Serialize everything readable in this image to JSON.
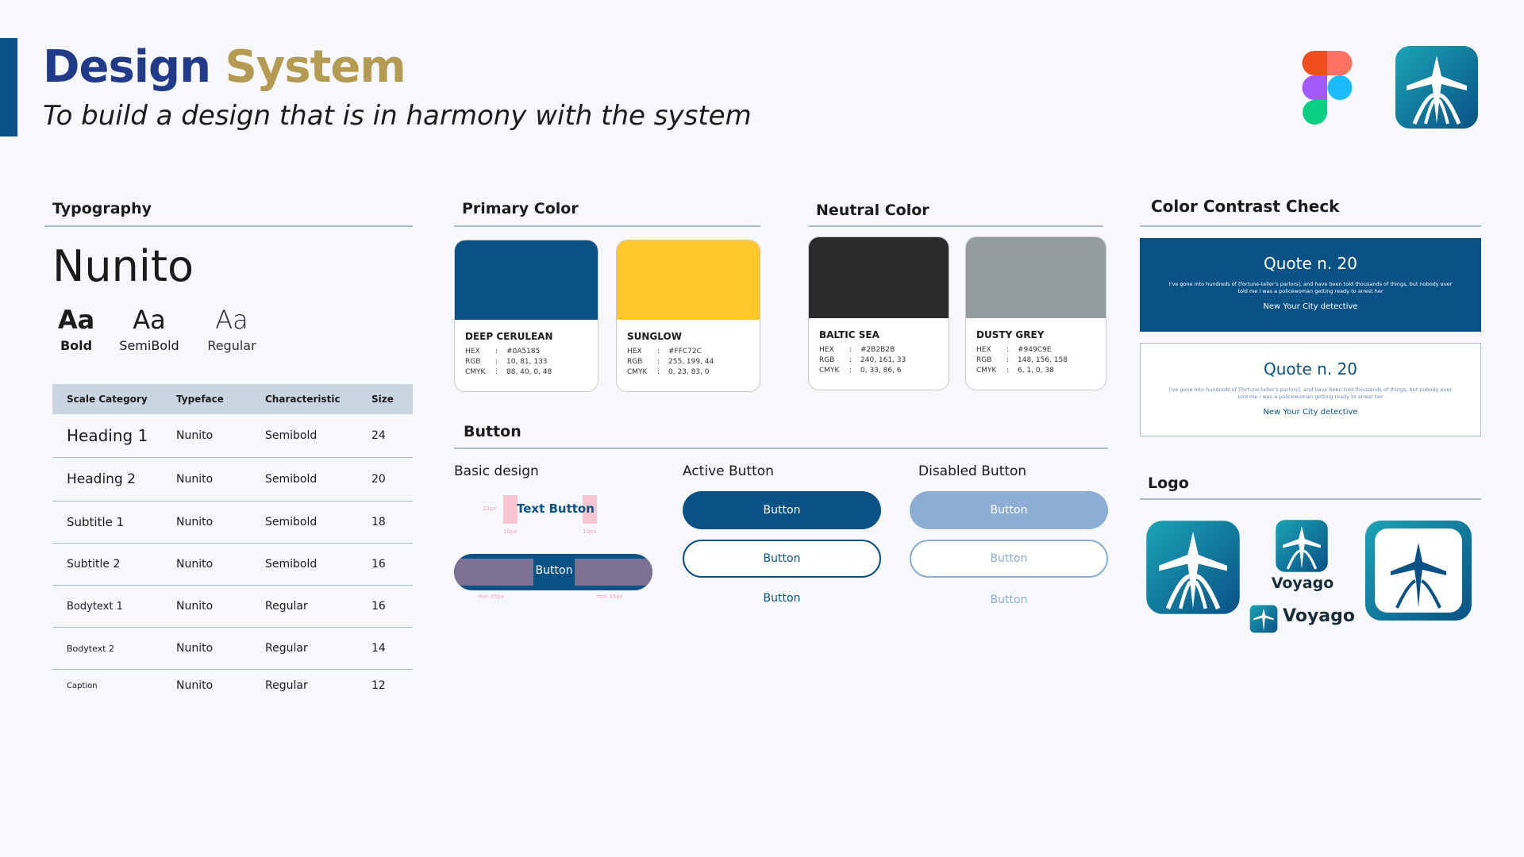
{
  "header": {
    "title_part1": "Design",
    "title_part2": "System",
    "subtitle": "To build a design that is in harmony with the system",
    "icons": [
      "figma-logo-icon",
      "voyago-app-icon"
    ]
  },
  "typography": {
    "section_title": "Typography",
    "font_name": "Nunito",
    "samples": [
      {
        "glyph": "Aa",
        "label": "Bold"
      },
      {
        "glyph": "Aa",
        "label": "SemiBold"
      },
      {
        "glyph": "Aa",
        "label": "Regular"
      }
    ],
    "columns": [
      "Scale Category",
      "Typeface",
      "Characteristic",
      "Size"
    ],
    "rows": [
      {
        "category": "Heading 1",
        "typeface": "Nunito",
        "characteristic": "Semibold",
        "size": "24"
      },
      {
        "category": "Heading 2",
        "typeface": "Nunito",
        "characteristic": "Semibold",
        "size": "20"
      },
      {
        "category": "Subtitle 1",
        "typeface": "Nunito",
        "characteristic": "Semibold",
        "size": "18"
      },
      {
        "category": "Subtitle 2",
        "typeface": "Nunito",
        "characteristic": "Semibold",
        "size": "16"
      },
      {
        "category": "Bodytext 1",
        "typeface": "Nunito",
        "characteristic": "Regular",
        "size": "16"
      },
      {
        "category": "Bodytext 2",
        "typeface": "Nunito",
        "characteristic": "Regular",
        "size": "14"
      },
      {
        "category": "Caption",
        "typeface": "Nunito",
        "characteristic": "Regular",
        "size": "12"
      }
    ]
  },
  "primary_color": {
    "section_title": "Primary Color",
    "swatches": [
      {
        "name": "DEEP CERULEAN",
        "color": "#0A5185",
        "hex": "#0A5185",
        "rgb": "10, 81, 133",
        "cmyk": "88, 40, 0, 48"
      },
      {
        "name": "SUNGLOW",
        "color": "#FFC72C",
        "hex": "#FFC72C",
        "rgb": "255, 199, 44",
        "cmyk": "0, 23, 83, 0"
      }
    ]
  },
  "neutral_color": {
    "section_title": "Neutral Color",
    "swatches": [
      {
        "name": "BALTIC SEA",
        "color": "#2B2B2B",
        "hex": "#2B2B2B",
        "rgb": "240, 161, 33",
        "cmyk": "0, 33, 86, 6"
      },
      {
        "name": "DUSTY GREY",
        "color": "#949C9E",
        "hex": "#949C9E",
        "rgb": "148, 156, 158",
        "cmyk": "6, 1, 0, 38"
      }
    ]
  },
  "swatch_keys": {
    "hex": "HEX",
    "rgb": "RGB",
    "cmyk": "CMYK",
    "sep": ":"
  },
  "button": {
    "section_title": "Button",
    "basic_title": "Basic design",
    "basic_text_button": "Text Button",
    "basic_button": "Button",
    "spec_23px": "23px",
    "spec_10px": "10px",
    "spec_min35": "min 35px",
    "active_title": "Active Button",
    "disabled_title": "Disabled Button",
    "label": "Button"
  },
  "contrast": {
    "section_title": "Color Contrast Check",
    "quote_title": "Quote n. 20",
    "quote_text": "I've gone into hundreds of [fortune-teller's parlors], and have been told thousands of things, but nobody ever told me I was a policewoman getting ready to arrest her",
    "quote_author": "New Your City detective"
  },
  "logo": {
    "section_title": "Logo",
    "wordmark": "Voyago"
  },
  "colors": {
    "accent": "#0A5185",
    "gold": "#FFC72C",
    "disabled": "#8EADD4"
  }
}
